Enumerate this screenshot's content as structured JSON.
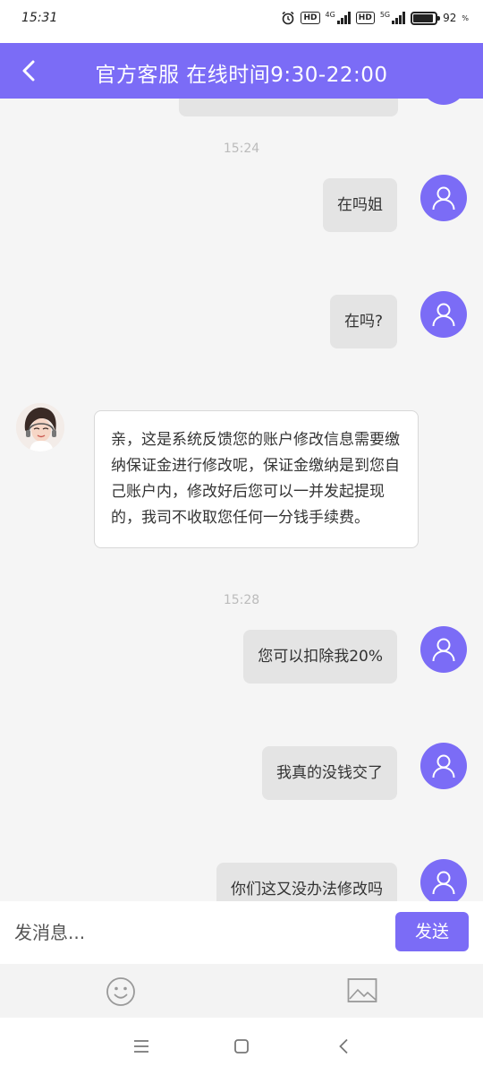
{
  "status_bar": {
    "time": "15:31",
    "network_4g": "4G",
    "network_5g": "5G",
    "hd": "HD",
    "battery": "92"
  },
  "header": {
    "title": "官方客服 在线时间9:30-22:00"
  },
  "chat": {
    "timestamp_1": "15:24",
    "msg_1": "在吗姐",
    "msg_2": "在吗?",
    "agent_msg": "亲，这是系统反馈您的账户修改信息需要缴纳保证金进行修改呢，保证金缴纳是到您自己账户内，修改好后您可以一并发起提现的，我司不收取您任何一分钱手续费。",
    "timestamp_2": "15:28",
    "msg_3": "您可以扣除我20%",
    "msg_4": "我真的没钱交了",
    "msg_5": "你们这又没办法修改吗"
  },
  "input": {
    "placeholder": "发消息...",
    "send_label": "发送"
  },
  "colors": {
    "accent": "#7b6cf6",
    "bubble_out": "#e4e4e4",
    "background": "#f5f5f5"
  },
  "icons": {
    "back": "chevron-left-icon",
    "user_avatar": "user-icon",
    "emoji": "smiley-icon",
    "image": "image-icon",
    "nav_menu": "menu-icon",
    "nav_home": "square-icon",
    "nav_back": "triangle-back-icon"
  }
}
